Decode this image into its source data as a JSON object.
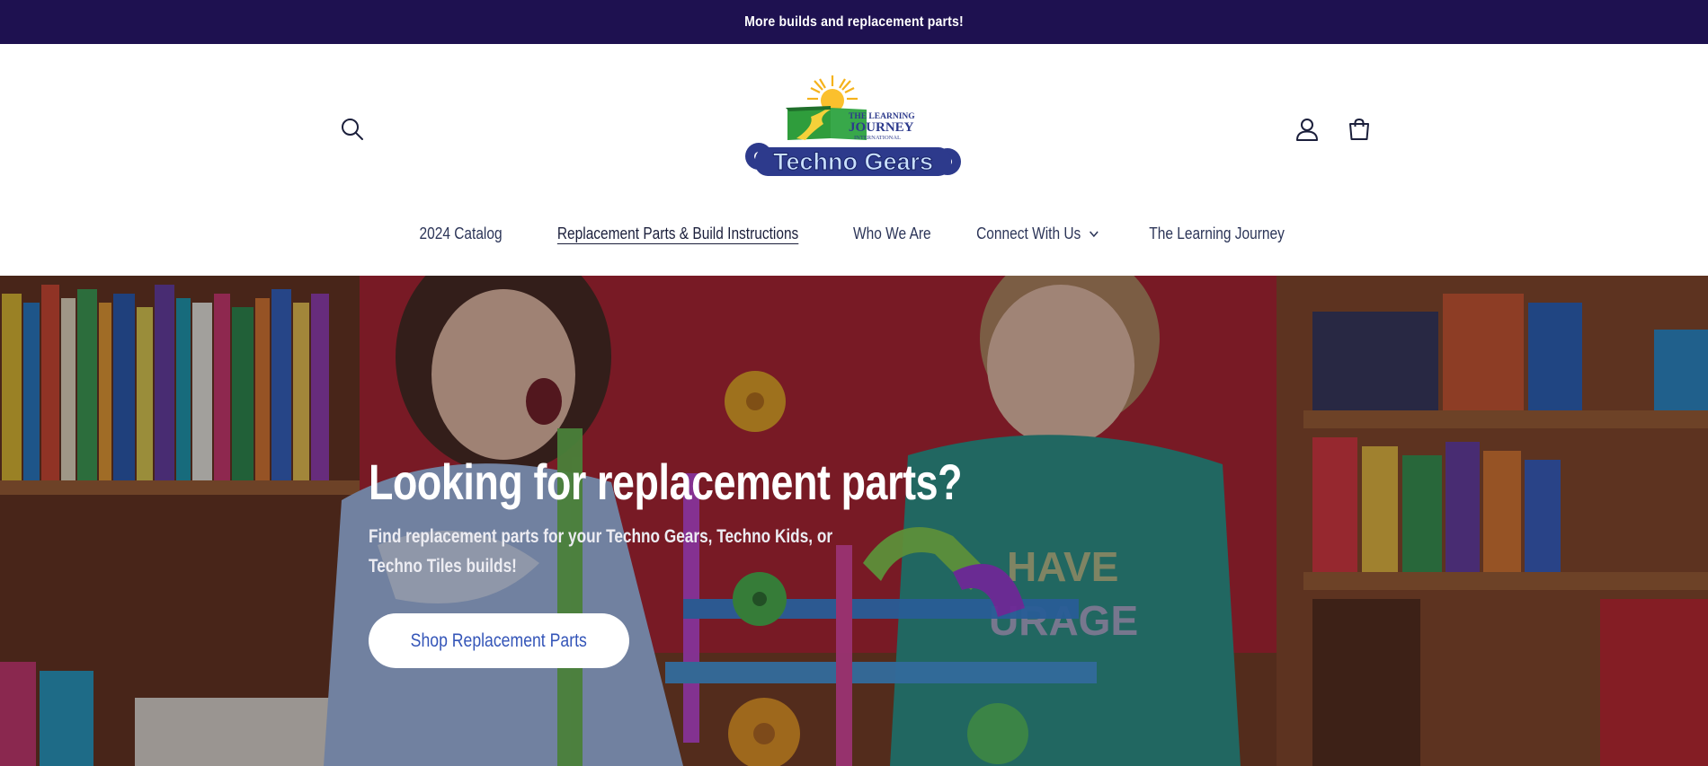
{
  "announcement": {
    "text": "More builds and replacement parts!"
  },
  "header": {
    "logo": {
      "line1": "THE LEARNING",
      "line2": "JOURNEY",
      "line3": "INTERNATIONAL",
      "brand": "Techno Gears"
    },
    "icons": {
      "search": "search-icon",
      "account": "account-icon",
      "cart": "cart-icon"
    }
  },
  "nav": {
    "items": [
      {
        "label": "2024 Catalog",
        "active": false,
        "dropdown": false
      },
      {
        "label": "Replacement Parts & Build Instructions",
        "active": true,
        "dropdown": false
      },
      {
        "label": "Who We Are",
        "active": false,
        "dropdown": false
      },
      {
        "label": "Connect With Us",
        "active": false,
        "dropdown": true
      },
      {
        "label": "The Learning Journey",
        "active": false,
        "dropdown": false
      }
    ]
  },
  "hero": {
    "title": "Looking for replacement parts?",
    "subtitle_line1": "Find replacement parts for your Techno Gears, Techno Kids, or",
    "subtitle_line2": "Techno Tiles builds!",
    "button_label": "Shop Replacement Parts",
    "shirt_text_line1": "HAVE",
    "shirt_text_line2": "URAGE"
  },
  "colors": {
    "announcement_bg": "#1e1150",
    "nav_text": "#2c3558",
    "button_text": "#3455b8"
  }
}
